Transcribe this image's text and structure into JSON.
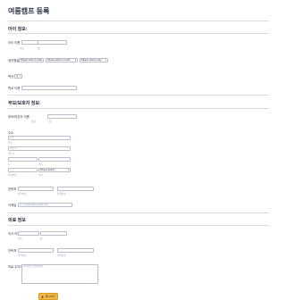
{
  "form": {
    "title": "여름캠프 등록",
    "sections": {
      "child": "아이 정보:",
      "parent": "부모/보호자 정보:",
      "medical": "의료 정보"
    },
    "child": {
      "name_label": "아이 이름",
      "first_sub": "이름",
      "last_sub": "성",
      "birth_label": "생년월일",
      "year_placeholder": "Please select a year",
      "month_placeholder": "Please select a month",
      "day_placeholder": "Please select a day",
      "gender_label": "학년",
      "gender_value": "남",
      "school_label": "학교 이름"
    },
    "parent": {
      "name_label": "부모/보호자 이름",
      "first_sub": "이름",
      "last_sub": "성",
      "address_label": "주소",
      "addr1_placeholder": "주소",
      "addr2_placeholder": "주소 2",
      "city_sub": "시",
      "state_sub": "주/도",
      "country_value": "Please Select",
      "zip_sub": "우편번호",
      "country_sub": "국가",
      "phone_label": "연락처",
      "phone_area_sub": "지역번호",
      "phone_num_sub": "전화번호",
      "email_label": "이메일",
      "email_placeholder": "ex: myname@example.com"
    },
    "medical": {
      "doctor_label": "의사 이름",
      "first_sub": "이름",
      "last_sub": "성",
      "phone_label": "연락처",
      "phone_area_sub": "지역번호",
      "phone_num_sub": "전화번호",
      "notes_label": "의료 주의사항",
      "notes_placeholder": "특이사항 입력하세요..."
    },
    "submit_label": "제출하기",
    "submit_icon": "lock-icon"
  },
  "colors": {
    "accent": "#f5b942",
    "text": "#2c3345",
    "muted": "#8894ab",
    "border": "#b8bdc9"
  }
}
